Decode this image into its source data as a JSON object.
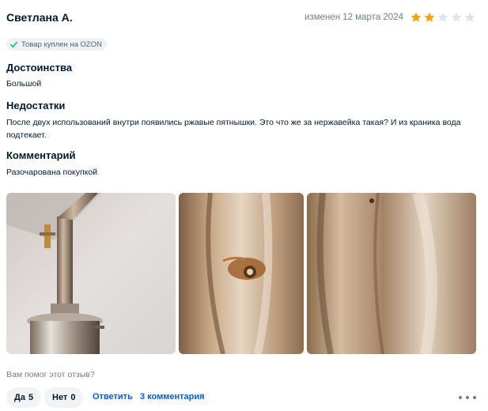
{
  "review": {
    "author": "Светлана А.",
    "date": "изменен 12 марта 2024",
    "rating": 2,
    "rating_max": 5,
    "star_color_filled": "#f9a400",
    "star_color_empty": "#e1e4e8",
    "badge": {
      "icon": "check-icon",
      "text": "Товар куплен на OZON",
      "icon_color": "#10c44c"
    },
    "pros": {
      "title": "Достоинства",
      "text": "Большой"
    },
    "cons": {
      "title": "Недостатки",
      "text": "После двух использований внутри появились ржавые пятнышки. Это что же за нержавейка такая? И из краника вода подтекает."
    },
    "comment": {
      "title": "Комментарий",
      "text": "Разочарована покупкой"
    },
    "photos": [
      "photo-distiller",
      "photo-rust-spot-closeup",
      "photo-inner-wall"
    ]
  },
  "footer": {
    "helpful_question": "Вам помог этот отзыв?",
    "yes_label": "Да",
    "yes_count": "5",
    "no_label": "Нет",
    "no_count": "0",
    "reply_label": "Ответить",
    "comments_label": "3 комментария",
    "more_icon": "more-dots-icon"
  },
  "colors": {
    "link": "#005bff",
    "muted": "#707f8d",
    "text": "#001a34"
  }
}
